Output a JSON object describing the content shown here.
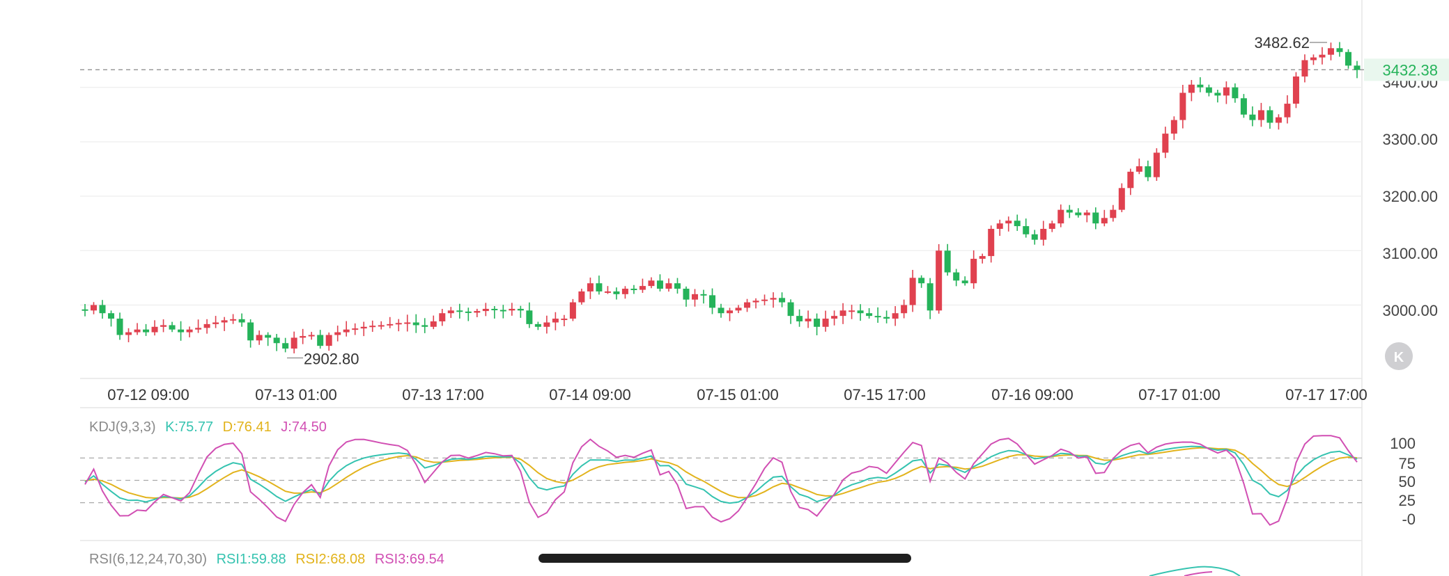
{
  "chart_data": {
    "type": "candlestick",
    "colors": {
      "up": "#e0414f",
      "down": "#25b35a",
      "k_line": "#35c3b0",
      "d_line": "#e2b31c",
      "j_line": "#d14fb3"
    },
    "price_axis": {
      "ylim": [
        2860,
        3535
      ],
      "ticks": [
        "3000.00",
        "3100.00",
        "3200.00",
        "3300.00",
        "3400.00"
      ],
      "tick_values": [
        3000,
        3100,
        3200,
        3300,
        3400
      ]
    },
    "time_labels": [
      "07-12 09:00",
      "07-13 01:00",
      "07-13 17:00",
      "07-14 09:00",
      "07-15 01:00",
      "07-15 17:00",
      "07-16 09:00",
      "07-17 01:00",
      "07-17 17:00"
    ],
    "last_price": {
      "value": 3432.38,
      "label": "3432.38"
    },
    "high_marker": {
      "value": 3482.62,
      "label": "3482.62"
    },
    "low_marker": {
      "value": 2902.8,
      "label": "2902.80"
    },
    "closes": [
      2990,
      3000,
      2985,
      2975,
      2945,
      2950,
      2955,
      2950,
      2960,
      2963,
      2955,
      2950,
      2955,
      2958,
      2965,
      2968,
      2972,
      2974,
      2968,
      2935,
      2945,
      2940,
      2930,
      2920,
      2940,
      2943,
      2945,
      2925,
      2945,
      2950,
      2955,
      2957,
      2960,
      2962,
      2963,
      2965,
      2967,
      2968,
      2963,
      2960,
      2970,
      2985,
      2990,
      2988,
      2986,
      2989,
      2993,
      2991,
      2990,
      2993,
      2990,
      2965,
      2960,
      2968,
      2975,
      2975,
      3005,
      3025,
      3040,
      3025,
      3025,
      3020,
      3030,
      3028,
      3035,
      3045,
      3030,
      3040,
      3030,
      3010,
      3020,
      3018,
      2995,
      2985,
      2990,
      2995,
      3005,
      3008,
      3010,
      3013,
      3005,
      2980,
      2970,
      2975,
      2960,
      2975,
      2980,
      2990,
      2990,
      2985,
      2980,
      2978,
      2975,
      2985,
      3000,
      3050,
      3040,
      2990,
      3100,
      3060,
      3045,
      3040,
      3085,
      3090,
      3140,
      3150,
      3155,
      3145,
      3130,
      3120,
      3140,
      3150,
      3175,
      3170,
      3165,
      3170,
      3150,
      3160,
      3175,
      3215,
      3245,
      3255,
      3235,
      3280,
      3315,
      3340,
      3390,
      3405,
      3400,
      3390,
      3385,
      3400,
      3380,
      3350,
      3340,
      3358,
      3335,
      3345,
      3370,
      3420,
      3450,
      3455,
      3460,
      3472,
      3465,
      3440,
      3432
    ],
    "opens": [
      2992,
      2990,
      3000,
      2985,
      2975,
      2945,
      2950,
      2955,
      2950,
      2960,
      2963,
      2955,
      2950,
      2955,
      2958,
      2965,
      2968,
      2972,
      2974,
      2968,
      2935,
      2945,
      2940,
      2930,
      2920,
      2940,
      2943,
      2945,
      2925,
      2945,
      2950,
      2955,
      2957,
      2960,
      2962,
      2963,
      2965,
      2967,
      2968,
      2963,
      2960,
      2970,
      2985,
      2990,
      2988,
      2986,
      2989,
      2993,
      2991,
      2990,
      2993,
      2990,
      2965,
      2960,
      2968,
      2975,
      2975,
      3005,
      3025,
      3040,
      3025,
      3025,
      3020,
      3030,
      3028,
      3035,
      3045,
      3030,
      3040,
      3030,
      3010,
      3020,
      3018,
      2995,
      2985,
      2990,
      2995,
      3005,
      3008,
      3010,
      3013,
      3005,
      2980,
      2970,
      2975,
      2960,
      2975,
      2980,
      2990,
      2990,
      2985,
      2980,
      2978,
      2975,
      2985,
      3000,
      3050,
      3040,
      2990,
      3100,
      3060,
      3045,
      3040,
      3085,
      3090,
      3140,
      3150,
      3155,
      3145,
      3130,
      3120,
      3140,
      3150,
      3175,
      3170,
      3165,
      3170,
      3150,
      3160,
      3175,
      3215,
      3245,
      3255,
      3235,
      3280,
      3315,
      3340,
      3390,
      3405,
      3400,
      3390,
      3385,
      3400,
      3380,
      3350,
      3340,
      3358,
      3335,
      3345,
      3370,
      3420,
      3450,
      3455,
      3460,
      3472,
      3465,
      3440
    ],
    "kdj": {
      "label": "KDJ(9,3,3)",
      "k_label": "K:75.77",
      "d_label": "D:76.41",
      "j_label": "J:74.50",
      "ylim": [
        -12,
        112
      ],
      "ticks": [
        "100",
        "75",
        "50",
        "25",
        "-0"
      ],
      "tick_values": [
        100,
        75,
        50,
        25,
        0
      ]
    },
    "rsi": {
      "label": "RSI(6,12,24,70,30)",
      "rsi1_label": "RSI1:59.88",
      "rsi2_label": "RSI2:68.08",
      "rsi3_label": "RSI3:69.54"
    }
  },
  "icons": {
    "kline_button": "K"
  }
}
